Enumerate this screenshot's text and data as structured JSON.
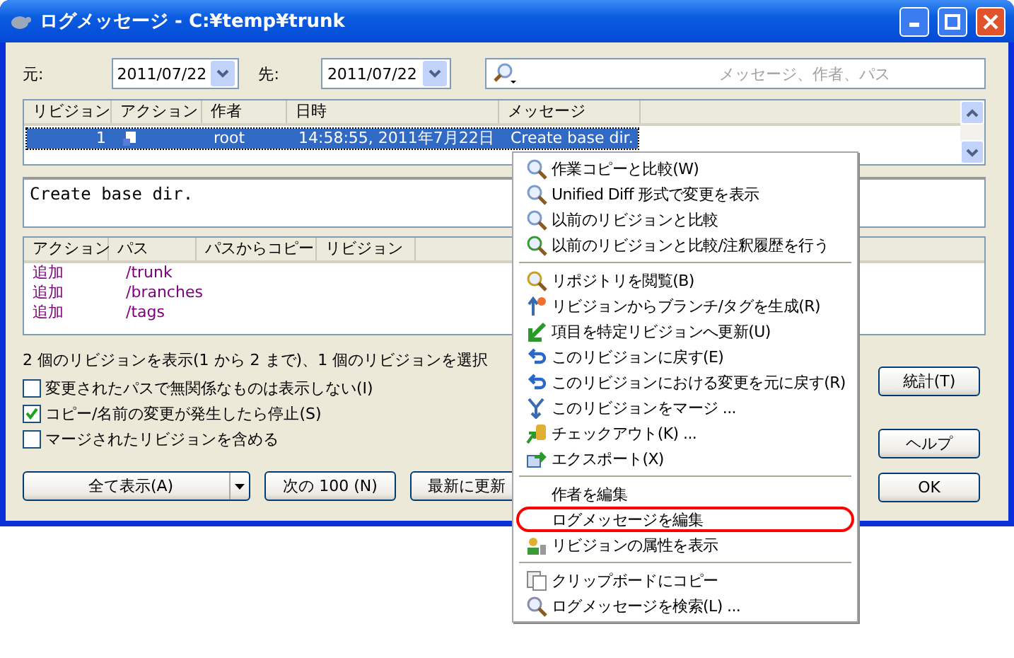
{
  "window": {
    "title": "ログメッセージ - C:¥temp¥trunk"
  },
  "filter": {
    "from_label": "元:",
    "from_value": "2011/07/22",
    "to_label": "先:",
    "to_value": "2011/07/22",
    "search_placeholder": "メッセージ、作者、パス"
  },
  "revisions": {
    "columns": [
      "リビジョン",
      "アクション",
      "作者",
      "日時",
      "メッセージ"
    ],
    "rows": [
      {
        "revision": "1",
        "author": "root",
        "date": "14:58:55, 2011年7月22日",
        "message": "Create base dir.",
        "selected": true
      }
    ]
  },
  "message": "Create base dir.",
  "changed_paths": {
    "columns": [
      "アクション",
      "パス",
      "パスからコピー",
      "リビジョン"
    ],
    "rows": [
      {
        "action": "追加",
        "path": "/trunk"
      },
      {
        "action": "追加",
        "path": "/branches"
      },
      {
        "action": "追加",
        "path": "/tags"
      }
    ]
  },
  "status": "2 個のリビジョンを表示(1 から 2 まで)、1 個のリビジョンを選択",
  "options": [
    {
      "label": "変更されたパスで無関係なものは表示しない(I)",
      "checked": false
    },
    {
      "label": "コピー/名前の変更が発生したら停止(S)",
      "checked": true
    },
    {
      "label": "マージされたリビジョンを含める",
      "checked": false
    }
  ],
  "bottom_buttons": [
    "全て表示(A)",
    "次の 100 (N)",
    "最新に更新"
  ],
  "side_buttons": [
    "統計(T)",
    "ヘルプ",
    "OK"
  ],
  "context_menu": [
    [
      {
        "label": "作業コピーと比較(W)",
        "highlighted": false
      },
      {
        "label": "Unified Diff 形式で変更を表示",
        "highlighted": false
      },
      {
        "label": "以前のリビジョンと比較",
        "highlighted": false
      },
      {
        "label": "以前のリビジョンと比較/注釈履歴を行う",
        "highlighted": false
      }
    ],
    [
      {
        "label": "リポジトリを閲覧(B)",
        "highlighted": false
      },
      {
        "label": "リビジョンからブランチ/タグを生成(R)",
        "highlighted": false
      },
      {
        "label": "項目を特定リビジョンへ更新(U)",
        "highlighted": false
      },
      {
        "label": "このリビジョンに戻す(E)",
        "highlighted": false
      },
      {
        "label": "このリビジョンにおける変更を元に戻す(R)",
        "highlighted": false
      },
      {
        "label": "このリビジョンをマージ ...",
        "highlighted": false
      },
      {
        "label": "チェックアウト(K) ...",
        "highlighted": false
      },
      {
        "label": "エクスポート(X)",
        "highlighted": false
      }
    ],
    [
      {
        "label": "作者を編集",
        "highlighted": false
      },
      {
        "label": "ログメッセージを編集",
        "highlighted": true
      },
      {
        "label": "リビジョンの属性を表示",
        "highlighted": false
      }
    ],
    [
      {
        "label": "クリップボードにコピー",
        "highlighted": false
      },
      {
        "label": "ログメッセージを検索(L) ...",
        "highlighted": false
      }
    ]
  ]
}
